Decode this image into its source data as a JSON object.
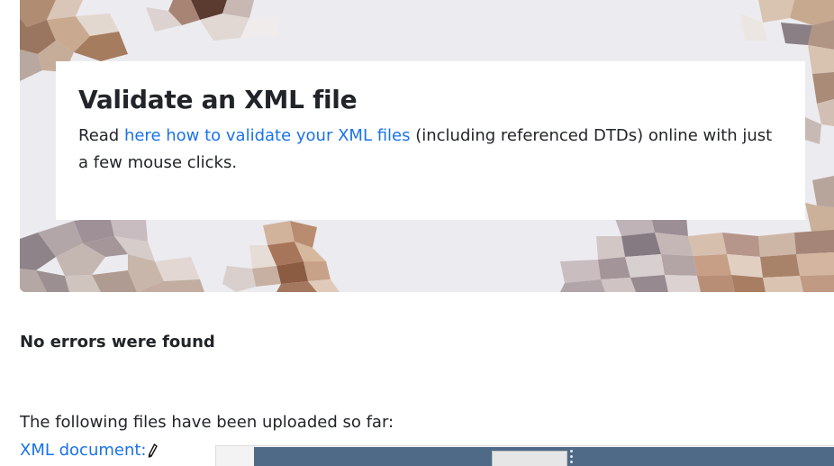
{
  "hero": {
    "title": "Validate an XML file",
    "text_before": "Read ",
    "link_text": "here how to validate your XML files",
    "text_after": " (including referenced DTDs) online with just a few mouse clicks."
  },
  "result": {
    "status": "No errors were found"
  },
  "uploads": {
    "intro": "The following files have been uploaded so far:",
    "xml_document_link": "XML document:"
  },
  "icons": {
    "edit": "pencil-icon"
  },
  "colors": {
    "link": "#1a73e8",
    "text": "#212529",
    "hero_background": "#ecebef"
  }
}
